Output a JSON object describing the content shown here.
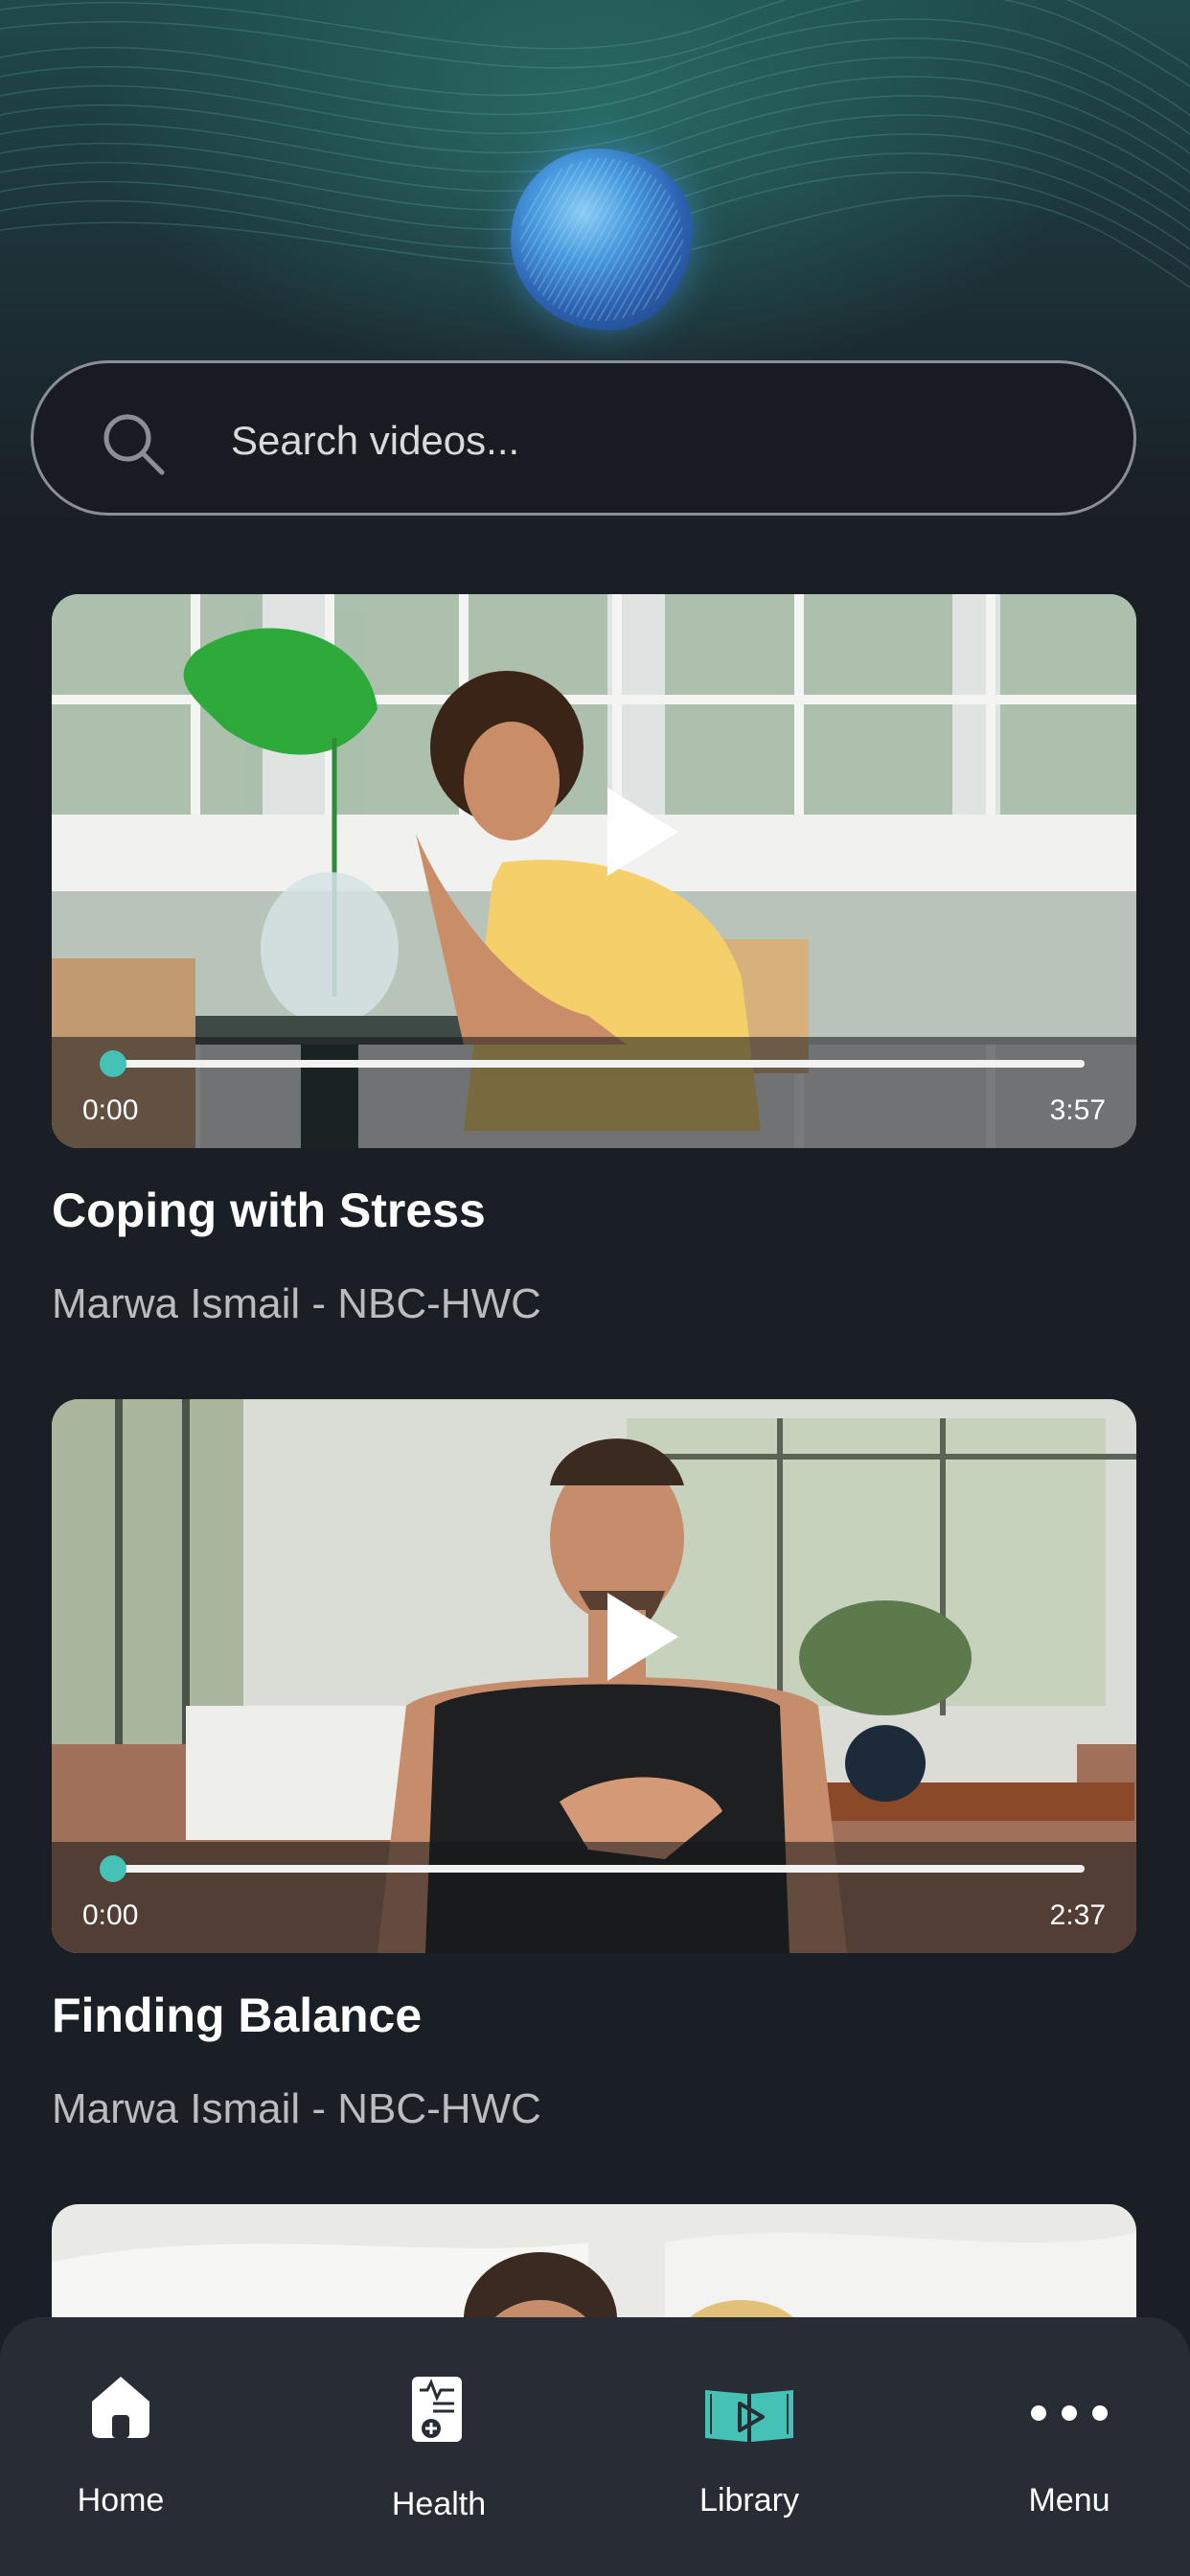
{
  "search": {
    "placeholder": "Search videos..."
  },
  "videos": [
    {
      "title": "Coping with Stress",
      "author": "Marwa Ismail - NBC-HWC",
      "current_time": "0:00",
      "duration": "3:57",
      "progress": 0
    },
    {
      "title": "Finding Balance",
      "author": "Marwa Ismail - NBC-HWC",
      "current_time": "0:00",
      "duration": "2:37",
      "progress": 0
    }
  ],
  "bottom_nav": {
    "items": [
      {
        "label": "Home",
        "icon": "home-icon",
        "active": false
      },
      {
        "label": "Health",
        "icon": "health-record-icon",
        "active": false
      },
      {
        "label": "Library",
        "icon": "video-library-icon",
        "active": true
      },
      {
        "label": "Menu",
        "icon": "more-dots-icon",
        "active": false
      }
    ]
  },
  "colors": {
    "background": "#1a1e25",
    "accent": "#45c1b6",
    "nav_background": "#272c35"
  }
}
